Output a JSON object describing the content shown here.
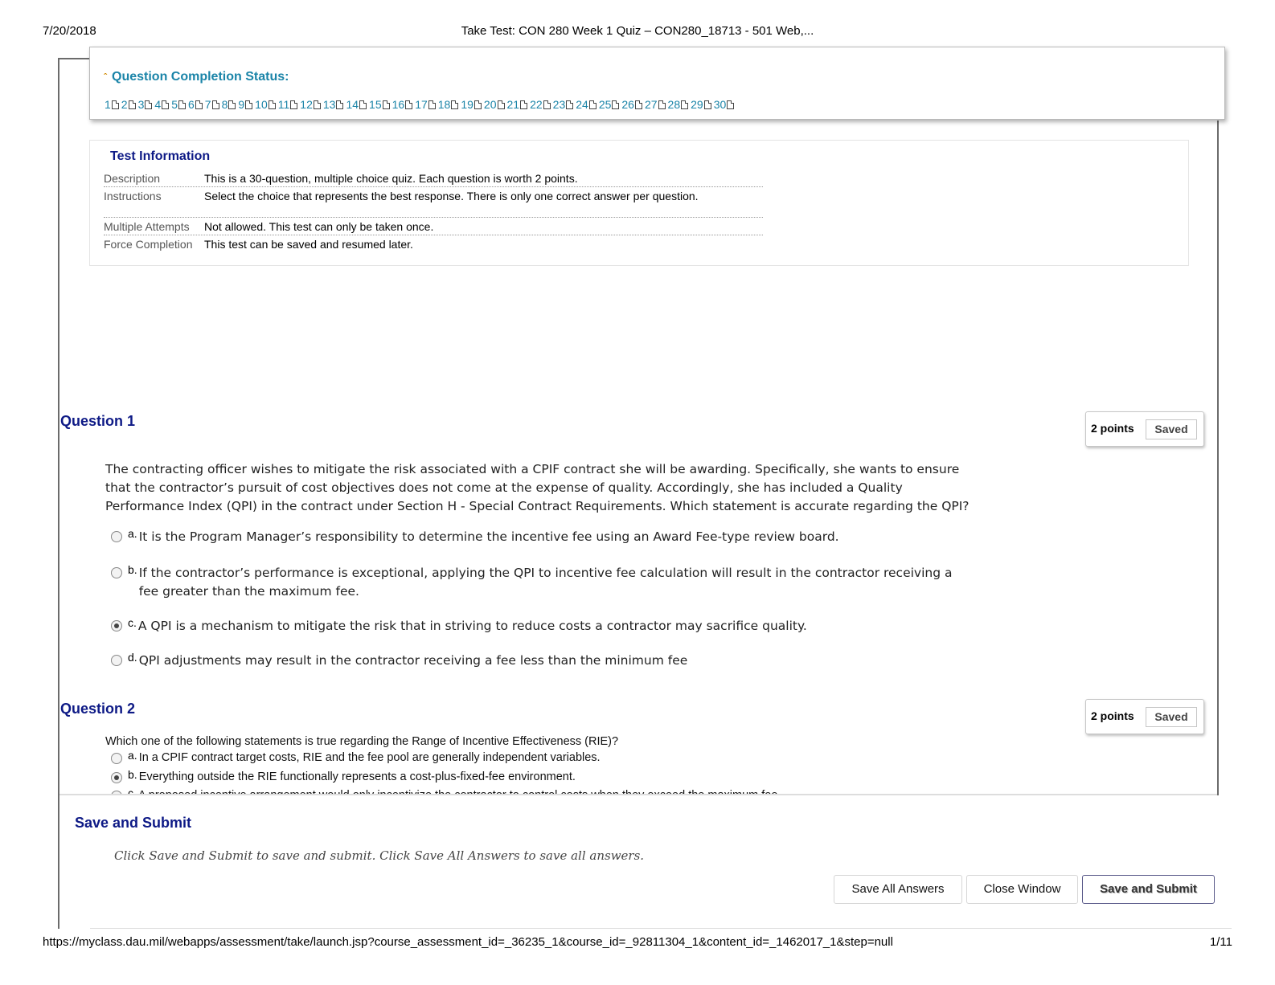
{
  "print_header": {
    "date": "7/20/2018",
    "title": "Take Test: CON 280 Week 1 Quiz – CON280_18713 - 501 Web,..."
  },
  "print_footer": {
    "url": "https://myclass.dau.mil/webapps/assessment/take/launch.jsp?course_assessment_id=_36235_1&course_id=_92811304_1&content_id=_1462017_1&step=null",
    "page": "1/11"
  },
  "completion_status": {
    "title": "Question Completion Status:",
    "chevron_icon": "double-chevron-up-icon",
    "questions": [
      "1",
      "2",
      "3",
      "4",
      "5",
      "6",
      "7",
      "8",
      "9",
      "10",
      "11",
      "12",
      "13",
      "14",
      "15",
      "16",
      "17",
      "18",
      "19",
      "20",
      "21",
      "22",
      "23",
      "24",
      "25",
      "26",
      "27",
      "28",
      "29",
      "30"
    ]
  },
  "test_info": {
    "title": "Test Information",
    "rows": [
      {
        "label": "Description",
        "value": "This is a 30-question, multiple choice quiz. Each question is worth 2 points."
      },
      {
        "label": "Instructions",
        "value": "Select the choice that represents the best response. There is only one correct answer per question."
      },
      {
        "label": "Multiple Attempts",
        "value": "Not allowed. This test can only be taken once."
      },
      {
        "label": "Force Completion",
        "value": "This test can be saved and resumed later."
      }
    ]
  },
  "questions": [
    {
      "heading": "Question 1",
      "points": "2 points",
      "status": "Saved",
      "text": "The contracting officer wishes to mitigate the risk associated with a CPIF contract she will be awarding. Specifically, she wants to ensure that the contractor’s pursuit of cost objectives does not come at the expense of quality. Accordingly, she has included a Quality Performance Index (QPI) in the contract under Section H - Special Contract Requirements. Which statement is accurate regarding the QPI?",
      "options": [
        {
          "letter": "a.",
          "text": "It is the Program Manager’s responsibility to determine the incentive fee using an Award Fee-type review board.",
          "selected": false
        },
        {
          "letter": "b.",
          "text": "If the contractor’s performance is exceptional, applying the QPI to incentive fee calculation will result in the contractor receiving a fee greater than the maximum fee.",
          "selected": false
        },
        {
          "letter": "c.",
          "text": "A QPI is a mechanism to mitigate the risk that in striving to reduce costs a contractor may sacrifice quality.",
          "selected": true
        },
        {
          "letter": "d.",
          "text": "QPI adjustments may result in the contractor receiving a fee less than the minimum fee",
          "selected": false
        }
      ]
    },
    {
      "heading": "Question 2",
      "points": "2 points",
      "status": "Saved",
      "text": "Which one of the following statements is true regarding the Range of Incentive Effectiveness (RIE)?",
      "options": [
        {
          "letter": "a.",
          "text": "In a CPIF contract target costs, RIE and the fee pool are generally independent variables.",
          "selected": false
        },
        {
          "letter": "b.",
          "text": "Everything outside the RIE functionally represents a cost-plus-fixed-fee environment.",
          "selected": true
        },
        {
          "letter": "c.",
          "text": "A proposed incentive arrangement would only incentivize the contractor to control costs when they exceed the maximum fee.",
          "selected": false
        }
      ]
    }
  ],
  "submit": {
    "title": "Save and Submit",
    "hint": "Click Save and Submit to save and submit. Click Save All Answers to save all answers.",
    "save_all_label": "Save All Answers",
    "close_label": "Close Window",
    "submit_label": "Save and Submit"
  }
}
